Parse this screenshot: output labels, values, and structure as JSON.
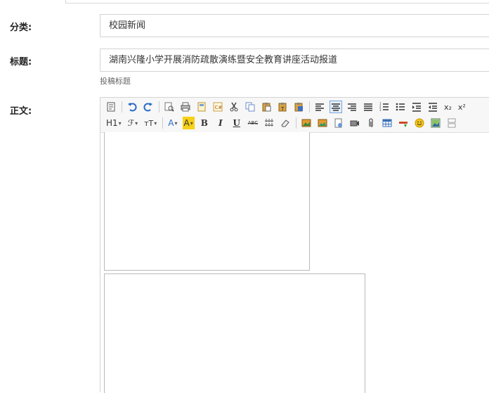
{
  "form": {
    "category_label": "分类:",
    "category_value": "校园新闻",
    "title_label": "标题:",
    "title_value": "湖南兴隆小学开展消防疏散演练暨安全教育讲座活动报道",
    "title_hint": "投稿标题",
    "body_label": "正文:"
  },
  "toolbar": {
    "heading_btn": "H1",
    "font_btn": "ℱ",
    "size_btn": "тT",
    "font_color_btn": "A",
    "bg_color_btn": "A",
    "bold_btn": "B",
    "italic_btn": "I",
    "underline_btn": "U",
    "strike_btn": "ABC",
    "subscript_btn": "x₂",
    "superscript_btn": "x²"
  },
  "colors": {
    "accent": "#1a5fb4",
    "highlight": "#f7d117",
    "border": "#d4d4d4"
  }
}
